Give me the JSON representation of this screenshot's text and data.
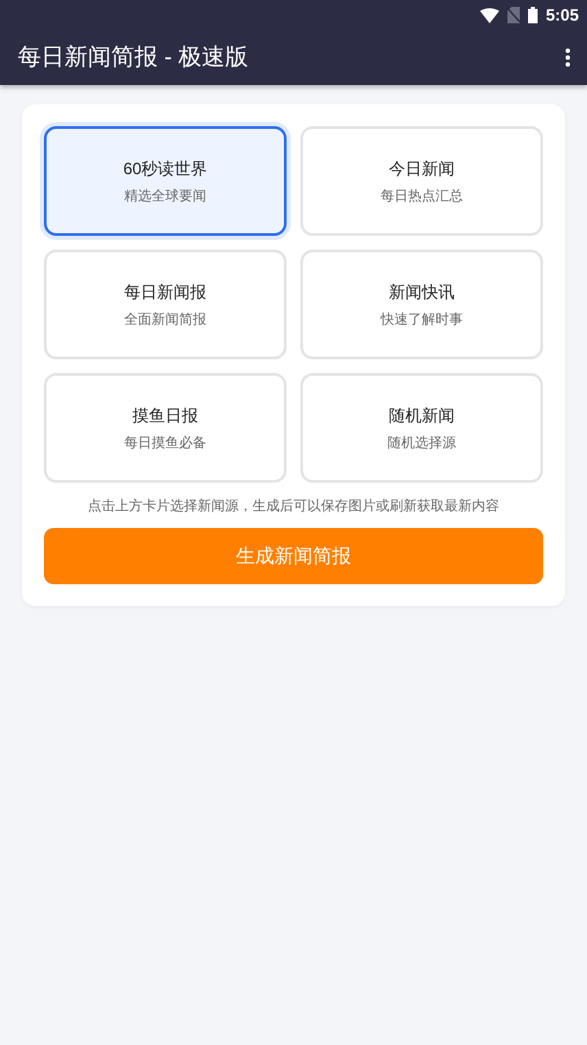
{
  "status_bar": {
    "time": "5:05"
  },
  "app_bar": {
    "title": "每日新闻简报 - 极速版"
  },
  "sources": [
    {
      "title": "60秒读世界",
      "subtitle": "精选全球要闻",
      "selected": true
    },
    {
      "title": "今日新闻",
      "subtitle": "每日热点汇总",
      "selected": false
    },
    {
      "title": "每日新闻报",
      "subtitle": "全面新闻简报",
      "selected": false
    },
    {
      "title": "新闻快讯",
      "subtitle": "快速了解时事",
      "selected": false
    },
    {
      "title": "摸鱼日报",
      "subtitle": "每日摸鱼必备",
      "selected": false
    },
    {
      "title": "随机新闻",
      "subtitle": "随机选择源",
      "selected": false
    }
  ],
  "hint": "点击上方卡片选择新闻源，生成后可以保存图片或刷新获取最新内容",
  "generate_button": "生成新闻简报"
}
